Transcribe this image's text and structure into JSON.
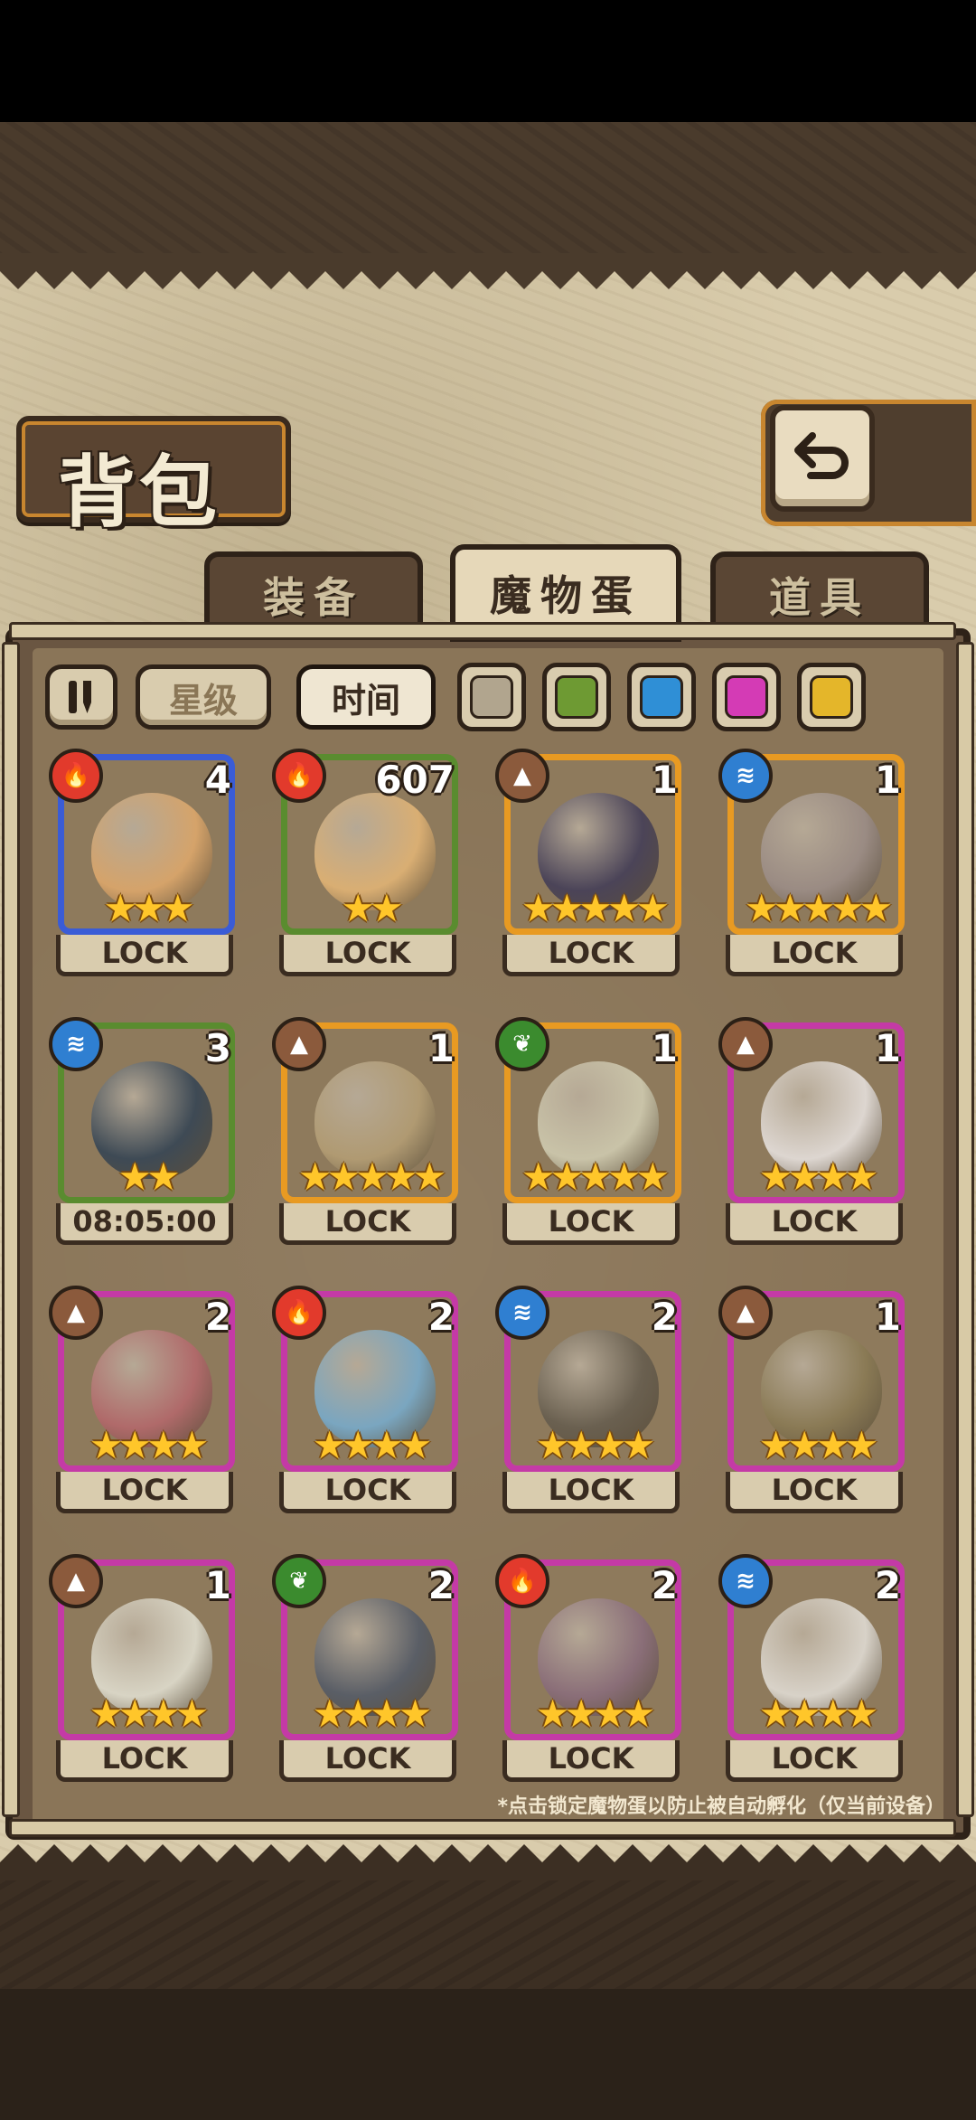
{
  "title": "背包",
  "tabs": [
    {
      "label": "装备",
      "active": false
    },
    {
      "label": "魔物蛋",
      "active": true
    },
    {
      "label": "道具",
      "active": false
    }
  ],
  "sort": {
    "star_label": "星级",
    "time_label": "时间",
    "active": "时间"
  },
  "filters": [
    "#b1a58e",
    "#6e9a33",
    "#2f8fd6",
    "#d43bb5",
    "#e4b62a"
  ],
  "elements": {
    "fire": {
      "color": "#e23a2c",
      "glyph": "🔥"
    },
    "earth": {
      "color": "#8b5a3c",
      "glyph": "▲"
    },
    "water": {
      "color": "#2f7fd1",
      "glyph": "≋"
    },
    "leaf": {
      "color": "#3b8b2e",
      "glyph": "❦"
    }
  },
  "items": [
    {
      "element": "fire",
      "count": "4",
      "stars": "★★★",
      "frame": "#3a5cd6",
      "egg": "#d5a36a",
      "footer": "LOCK"
    },
    {
      "element": "fire",
      "count": "607",
      "stars": "★★",
      "frame": "#5a8c2f",
      "egg": "#d9ae73",
      "footer": "LOCK"
    },
    {
      "element": "earth",
      "count": "1",
      "stars": "★★★★★",
      "frame": "#e89a22",
      "egg": "#4b4458",
      "footer": "LOCK"
    },
    {
      "element": "water",
      "count": "1",
      "stars": "★★★★★",
      "frame": "#e89a22",
      "egg": "#9a8b83",
      "footer": "LOCK"
    },
    {
      "element": "water",
      "count": "3",
      "stars": "★★",
      "frame": "#5a8c2f",
      "egg": "#3e4a55",
      "footer": "08:05:00"
    },
    {
      "element": "earth",
      "count": "1",
      "stars": "★★★★★",
      "frame": "#e89a22",
      "egg": "#b09a72",
      "footer": "LOCK"
    },
    {
      "element": "leaf",
      "count": "1",
      "stars": "★★★★★",
      "frame": "#e89a22",
      "egg": "#c9c3a8",
      "footer": "LOCK"
    },
    {
      "element": "earth",
      "count": "1",
      "stars": "★★★★",
      "frame": "#c43aa6",
      "egg": "#ddd6d0",
      "footer": "LOCK"
    },
    {
      "element": "earth",
      "count": "2",
      "stars": "★★★★",
      "frame": "#c43aa6",
      "egg": "#b06a6a",
      "footer": "LOCK"
    },
    {
      "element": "fire",
      "count": "2",
      "stars": "★★★★",
      "frame": "#c43aa6",
      "egg": "#7aa6c0",
      "footer": "LOCK"
    },
    {
      "element": "water",
      "count": "2",
      "stars": "★★★★",
      "frame": "#c43aa6",
      "egg": "#6a6050",
      "footer": "LOCK"
    },
    {
      "element": "earth",
      "count": "1",
      "stars": "★★★★",
      "frame": "#c43aa6",
      "egg": "#8a7a55",
      "footer": "LOCK"
    },
    {
      "element": "earth",
      "count": "1",
      "stars": "★★★★",
      "frame": "#c43aa6",
      "egg": "#d8d4c4",
      "footer": "LOCK"
    },
    {
      "element": "leaf",
      "count": "2",
      "stars": "★★★★",
      "frame": "#c43aa6",
      "egg": "#5a5e66",
      "footer": "LOCK"
    },
    {
      "element": "fire",
      "count": "2",
      "stars": "★★★★",
      "frame": "#c43aa6",
      "egg": "#8a6e78",
      "footer": "LOCK"
    },
    {
      "element": "water",
      "count": "2",
      "stars": "★★★★",
      "frame": "#c43aa6",
      "egg": "#d8d2c8",
      "footer": "LOCK"
    }
  ],
  "note": "*点击锁定魔物蛋以防止被自动孵化（仅当前设备）"
}
